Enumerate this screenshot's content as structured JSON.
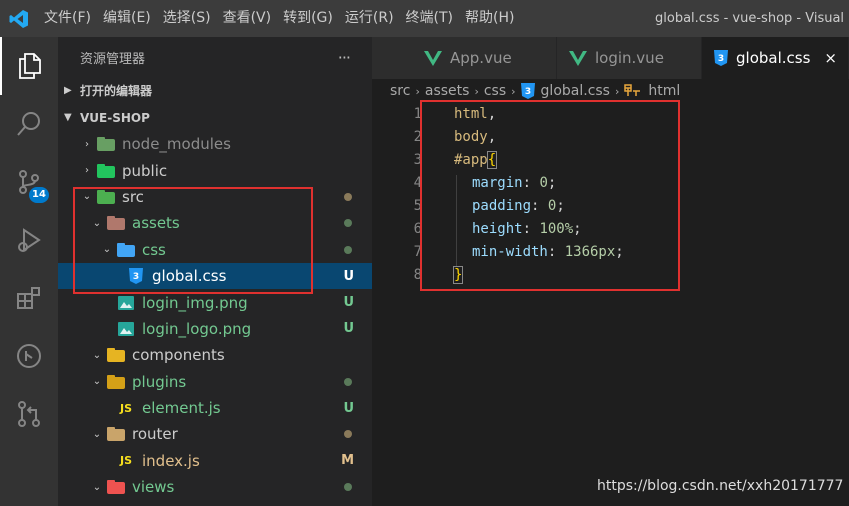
{
  "titlebar": {
    "menu": [
      "文件(F)",
      "编辑(E)",
      "选择(S)",
      "查看(V)",
      "转到(G)",
      "运行(R)",
      "终端(T)",
      "帮助(H)"
    ],
    "window_title": "global.css - vue-shop - Visual S"
  },
  "activity": {
    "scm_badge": "14"
  },
  "sidebar": {
    "title": "资源管理器",
    "more": "···",
    "open_editors": "打开的编辑器",
    "project": "VUE-SHOP",
    "tree": [
      {
        "label": "node_modules",
        "color": "#8c8c8c"
      },
      {
        "label": "public",
        "color": "#cccccc"
      },
      {
        "label": "src",
        "color": "#cccccc"
      },
      {
        "label": "assets",
        "color": "#73c991"
      },
      {
        "label": "css",
        "color": "#73c991"
      },
      {
        "label": "global.css",
        "color": "#ffffff",
        "status": "U"
      },
      {
        "label": "login_img.png",
        "color": "#73c991",
        "status": "U"
      },
      {
        "label": "login_logo.png",
        "color": "#73c991",
        "status": "U"
      },
      {
        "label": "components",
        "color": "#cccccc"
      },
      {
        "label": "plugins",
        "color": "#73c991"
      },
      {
        "label": "element.js",
        "color": "#73c991",
        "status": "U"
      },
      {
        "label": "router",
        "color": "#cccccc"
      },
      {
        "label": "index.js",
        "color": "#e2c08d",
        "status": "M"
      },
      {
        "label": "views",
        "color": "#73c991"
      }
    ]
  },
  "tabs": [
    {
      "label": "App.vue"
    },
    {
      "label": "login.vue"
    },
    {
      "label": "global.css",
      "close": "×"
    }
  ],
  "breadcrumb": [
    "src",
    "assets",
    "css",
    "global.css",
    "html"
  ],
  "editor": {
    "line_numbers": [
      "1",
      "2",
      "3",
      "4",
      "5",
      "6",
      "7",
      "8"
    ],
    "lines": [
      {
        "sel": "html",
        "punc": ","
      },
      {
        "sel": "body",
        "punc": ","
      },
      {
        "sel": "#app",
        "brace": "{"
      },
      {
        "prop": "margin",
        "val": "0"
      },
      {
        "prop": "padding",
        "val": "0"
      },
      {
        "prop": "height",
        "val": "100%"
      },
      {
        "prop": "min-width",
        "val": "1366px"
      },
      {
        "brace": "}"
      }
    ]
  },
  "watermark": "https://blog.csdn.net/xxh20171777",
  "colors": {
    "accent": "#007acc",
    "selection": "#094771",
    "annotation": "#e0312f"
  }
}
